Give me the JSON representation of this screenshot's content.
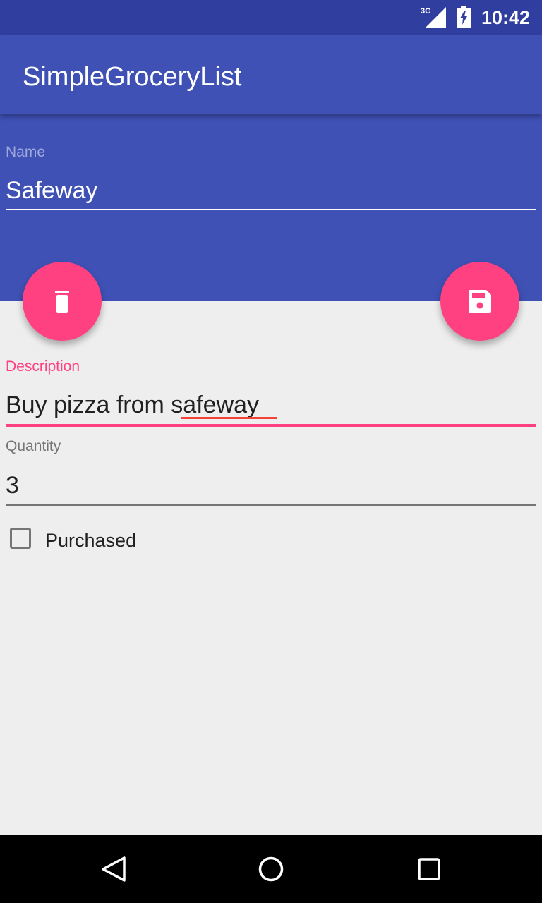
{
  "status_bar": {
    "network": "3G",
    "time": "10:42",
    "signal_icon": "signal-icon",
    "battery_icon": "battery-charging-icon"
  },
  "app_bar": {
    "title": "SimpleGroceryList"
  },
  "form": {
    "name": {
      "label": "Name",
      "value": "Safeway"
    },
    "description": {
      "label": "Description",
      "value": "Buy pizza from safeway"
    },
    "quantity": {
      "label": "Quantity",
      "value": "3"
    },
    "purchased": {
      "label": "Purchased",
      "checked": false
    }
  },
  "actions": {
    "delete_icon": "trash-icon",
    "save_icon": "floppy-disk-icon"
  },
  "nav_bar": {
    "back_icon": "back-icon",
    "home_icon": "home-icon",
    "recent_icon": "recent-apps-icon"
  },
  "colors": {
    "primary": "#3f51b5",
    "primary_dark": "#303f9f",
    "accent": "#ff4081",
    "background": "#eeeeee"
  }
}
